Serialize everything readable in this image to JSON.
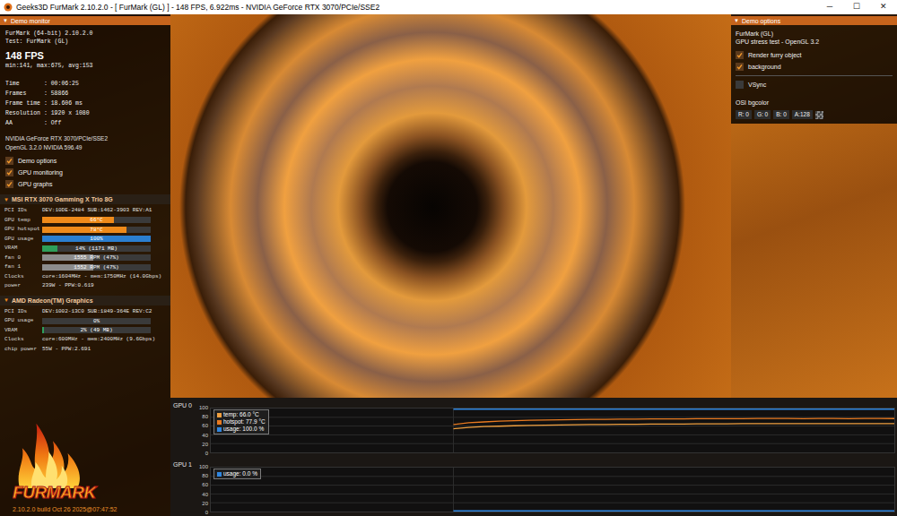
{
  "window": {
    "title": "Geeks3D FurMark 2.10.2.0 - [ FurMark (GL) ] - 148 FPS, 6.922ms - NVIDIA GeForce RTX 3070/PCIe/SSE2",
    "controls": [
      "─",
      "☐",
      "✕"
    ]
  },
  "monitor": {
    "icon": "▼",
    "header": "Demo monitor",
    "app": "FurMark (64-bit) 2.10.2.0",
    "test": "Test: FurMark (GL)",
    "fps": "148 FPS",
    "fps_stats": "min:141, max:675, avg:153",
    "stats": [
      "Time       : 00:06:25",
      "Frames     : 58866",
      "Frame time : 18.606 ms",
      "Resolution : 1920 x 1080",
      "AA         : Off"
    ],
    "renderer": "NVIDIA GeForce RTX 3070/PCIe/SSE2",
    "gl": "OpenGL 3.2.0 NVIDIA 596.49",
    "toggles": [
      {
        "label": "Demo options",
        "checked": true
      },
      {
        "label": "GPU monitoring",
        "checked": true
      },
      {
        "label": "GPU graphs",
        "checked": true
      }
    ]
  },
  "gpus": [
    {
      "icon": "▼",
      "name": "MSI RTX 3070 Gamming X Trio 8G",
      "expanded": true,
      "rows": [
        {
          "kind": "text",
          "label": "PCI IDs",
          "value": "DEV:10DE-2484 SUB:1462-3903 REV:A1"
        },
        {
          "kind": "bar",
          "label": "GPU temp",
          "value": "66°C",
          "level": 0.66,
          "color": "#ef8a1a"
        },
        {
          "kind": "bar",
          "label": "GPU hotspot",
          "value": "78°C",
          "level": 0.78,
          "color": "#ef8a1a"
        },
        {
          "kind": "bar",
          "label": "GPU usage",
          "value": "100%",
          "level": 1,
          "color": "#2b7fd0"
        },
        {
          "kind": "bar",
          "label": "VRAM",
          "value": "14% (1171 MB)",
          "level": 0.14,
          "color": "#2e9e5a"
        },
        {
          "kind": "bar",
          "label": "fan 0",
          "value": "1555 RPM (47%)",
          "level": 0.47,
          "color": "#8c8c8c"
        },
        {
          "kind": "bar",
          "label": "fan 1",
          "value": "1552 RPM (47%)",
          "level": 0.47,
          "color": "#8c8c8c"
        },
        {
          "kind": "text",
          "label": "Clocks",
          "value": "core:1604MHz - mem:1750MHz (14.0Gbps)"
        },
        {
          "kind": "text",
          "label": "power",
          "value": "239W - PPW:0.619"
        }
      ]
    },
    {
      "icon": "▼",
      "name": "AMD Radeon(TM) Graphics",
      "expanded": true,
      "rows": [
        {
          "kind": "text",
          "label": "PCI IDs",
          "value": "DEV:1002-13C0 SUB:1849-364E REV:C2"
        },
        {
          "kind": "bar",
          "label": "GPU usage",
          "value": "0%",
          "level": 0,
          "color": "#2b7fd0"
        },
        {
          "kind": "bar",
          "label": "VRAM",
          "value": "2% (49 MB)",
          "level": 0.02,
          "color": "#2e9e5a"
        },
        {
          "kind": "text",
          "label": "Clocks",
          "value": "core:600MHz - mem:2400MHz (9.6Gbps)"
        },
        {
          "kind": "text",
          "label": "chip power",
          "value": "55W - PPW:2.691"
        }
      ]
    }
  ],
  "logo": {
    "text": "FURMARK",
    "build": "2.10.2.0 build Oct 26 2025@07:47:52"
  },
  "options": {
    "icon": "▼",
    "header": "Demo options",
    "title": "FurMark (GL)",
    "subtitle": "GPU stress test - OpenGL 3.2",
    "toggles": [
      {
        "label": "Render furry object",
        "checked": true
      },
      {
        "label": "background",
        "checked": true
      }
    ],
    "vsync": {
      "label": "VSync",
      "checked": false
    },
    "bgcolor": {
      "label": "OSI bgcolor",
      "fields": [
        "R: 0",
        "G: 0",
        "B: 0",
        "A:128"
      ]
    }
  },
  "graphs": [
    {
      "label": "GPU 0",
      "ticks": [
        "100",
        "80",
        "60",
        "40",
        "20",
        "0"
      ],
      "series": [
        {
          "name": "temp: 66.0 °C",
          "color": "#f0a040",
          "values": [
            54,
            57,
            59,
            60,
            61,
            62,
            62.5,
            63,
            63.5,
            64,
            64,
            64.5,
            64.5,
            65,
            65,
            65,
            65.5,
            65.5,
            65.5,
            66,
            66,
            66,
            66,
            66,
            66,
            66,
            66,
            66,
            66,
            66
          ]
        },
        {
          "name": "hotspot: 77.9 °C",
          "color": "#e87a20",
          "values": [
            64,
            68,
            70,
            72,
            73,
            74,
            74.5,
            75,
            75.5,
            76,
            76,
            76.5,
            76.5,
            77,
            77,
            77,
            77.5,
            77.5,
            77.5,
            77.5,
            78,
            78,
            78,
            77.5,
            78,
            78,
            77.5,
            78,
            78,
            77.9
          ]
        },
        {
          "name": "usage: 100.0 %",
          "color": "#2f86e0",
          "values": [
            100,
            100,
            100,
            100,
            100,
            100,
            100,
            100,
            100,
            100,
            100,
            100,
            100,
            100,
            100,
            100,
            100,
            100,
            100,
            100,
            100,
            100,
            100,
            100,
            100,
            100,
            100,
            100,
            100,
            100
          ]
        }
      ]
    },
    {
      "label": "GPU 1",
      "ticks": [
        "100",
        "80",
        "60",
        "40",
        "20",
        "0"
      ],
      "series": [
        {
          "name": "usage: 0.0 %",
          "color": "#2f86e0",
          "values": [
            0,
            0,
            0,
            0,
            0,
            0,
            0,
            0,
            0,
            0,
            0,
            0,
            0,
            0,
            0,
            0,
            0,
            0,
            0,
            0,
            0,
            0,
            0,
            0,
            0,
            0,
            0,
            0,
            0,
            0
          ]
        }
      ]
    }
  ]
}
